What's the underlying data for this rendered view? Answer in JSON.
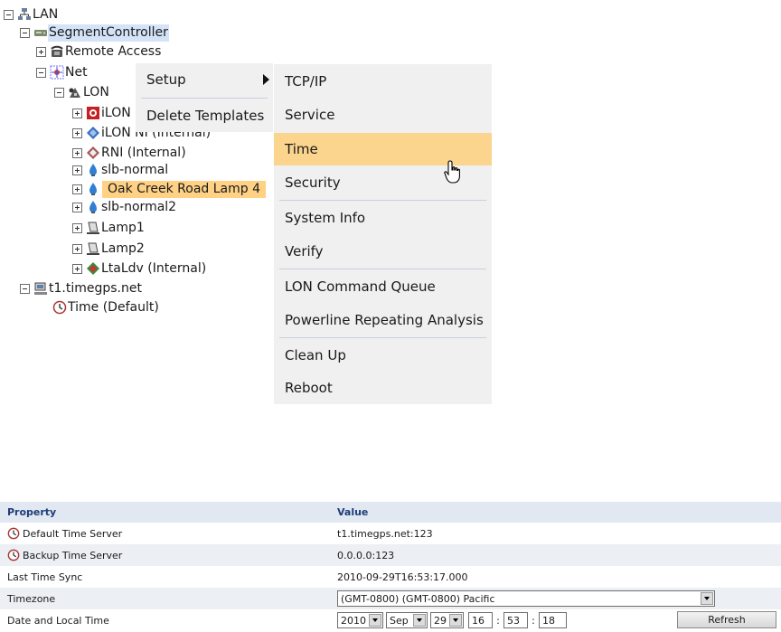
{
  "tree": {
    "lan": "LAN",
    "segment_controller": "SegmentController",
    "remote_access": "Remote Access",
    "net": "Net",
    "lon": "LON",
    "ilon": "iLON",
    "ilon_ni": "iLON NI (Internal)",
    "rni": "RNI (Internal)",
    "slb_normal": "slb-normal",
    "oak_creek": "Oak Creek Road Lamp 4",
    "slb_normal2": "slb-normal2",
    "lamp1": "Lamp1",
    "lamp2": "Lamp2",
    "ltaldv": "LtaLdv (Internal)",
    "timegps": "t1.timegps.net",
    "time_default": "Time (Default)"
  },
  "context_menu": {
    "setup": "Setup",
    "delete_templates": "Delete Templates"
  },
  "setup_submenu": {
    "tcpip": "TCP/IP",
    "service": "Service",
    "time": "Time",
    "security": "Security",
    "system_info": "System Info",
    "verify": "Verify",
    "lon_command_queue": "LON Command Queue",
    "powerline": "Powerline Repeating Analysis",
    "clean_up": "Clean Up",
    "reboot": "Reboot"
  },
  "properties": {
    "header_property": "Property",
    "header_value": "Value",
    "default_time_server_label": "Default Time Server",
    "default_time_server_value": "t1.timegps.net:123",
    "backup_time_server_label": "Backup Time Server",
    "backup_time_server_value": "0.0.0.0:123",
    "last_time_sync_label": "Last Time Sync",
    "last_time_sync_value": "2010-09-29T16:53:17.000",
    "timezone_label": "Timezone",
    "timezone_value": "(GMT-0800) (GMT-0800) Pacific",
    "date_local_label": "Date and Local Time",
    "year": "2010",
    "month": "Sep",
    "day": "29",
    "hour": "16",
    "minute": "53",
    "second": "18",
    "refresh_label": "Refresh"
  },
  "colors": {
    "menu_bg": "#f0f0f0",
    "menu_active": "#fbd48d",
    "tree_selected": "#d4e3f7",
    "tree_highlight": "#ffd185",
    "table_header_text": "#1e3c78"
  }
}
